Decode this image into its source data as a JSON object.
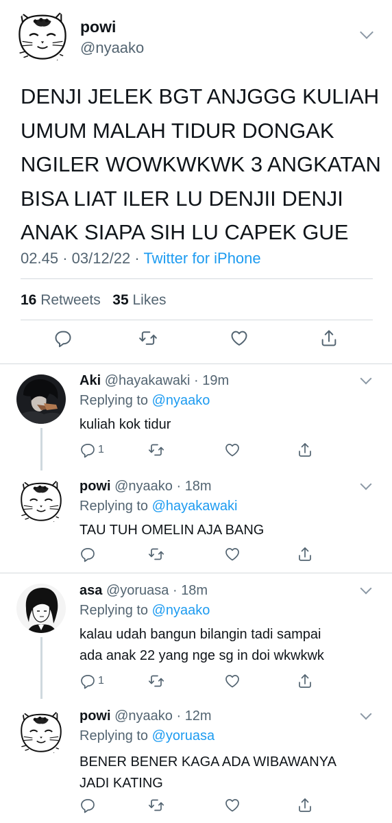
{
  "main_tweet": {
    "display_name": "powi",
    "handle": "@nyaako",
    "text_lines": [
      "DENJI JELEK BGT ANJGGG KULIAH",
      "UMUM MALAH TIDUR DONGAK",
      "NGILER WOWKWKWK 3 ANGKATAN",
      "BISA LIAT ILER LU DENJII DENJI",
      "ANAK SIAPA SIH LU CAPEK GUE"
    ],
    "time": "02.45",
    "date": "03/12/22",
    "source": "Twitter for iPhone",
    "retweets_count": "16",
    "retweets_label": "Retweets",
    "likes_count": "35",
    "likes_label": "Likes"
  },
  "replies": [
    {
      "display_name": "Aki",
      "handle": "@hayakawaki",
      "age": "19m",
      "replying_label": "Replying to",
      "replying_to": "@nyaako",
      "text_lines": [
        "kuliah kok tidur"
      ],
      "reply_count": "1"
    },
    {
      "display_name": "powi",
      "handle": "@nyaako",
      "age": "18m",
      "replying_label": "Replying to",
      "replying_to": "@hayakawaki",
      "text_lines": [
        "TAU TUH OMELIN AJA BANG"
      ],
      "reply_count": ""
    },
    {
      "display_name": "asa",
      "handle": "@yoruasa",
      "age": "18m",
      "replying_label": "Replying to",
      "replying_to": "@nyaako",
      "text_lines": [
        "kalau udah bangun bilangin tadi sampai",
        "ada anak 22 yang nge sg in doi wkwkwk"
      ],
      "reply_count": "1"
    },
    {
      "display_name": "powi",
      "handle": "@nyaako",
      "age": "12m",
      "replying_label": "Replying to",
      "replying_to": "@yoruasa",
      "text_lines": [
        "BENER BENER KAGA ADA WIBAWANYA",
        "JADI KATING"
      ],
      "reply_count": ""
    }
  ],
  "icons": {
    "reply": "reply-icon",
    "retweet": "retweet-icon",
    "like": "heart-icon",
    "share": "share-icon",
    "more": "chevron-down-icon"
  },
  "colors": {
    "text": "#0f1419",
    "secondary": "#536471",
    "accent": "#1d9bf0",
    "divider": "#d4d9dd"
  }
}
